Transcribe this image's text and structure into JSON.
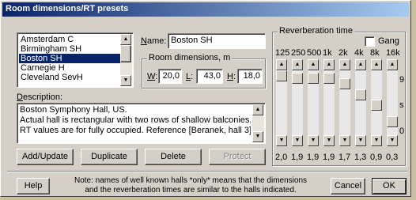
{
  "window": {
    "title": "Room dimensions/RT presets"
  },
  "halls": {
    "items": [
      "Amsterdam C",
      "Birmingham SH",
      "Boston SH",
      "Carnegie H",
      "Cleveland SevH"
    ],
    "selected_index": 2
  },
  "name": {
    "label": "Name:",
    "value": "Boston SH"
  },
  "room_dims": {
    "label": "Room dimensions, m",
    "w_label": "W:",
    "w_value": "20,0",
    "l_label": "L:",
    "l_value": "43,0",
    "h_label": "H:",
    "h_value": "18,0"
  },
  "description": {
    "label": "Description:",
    "text": "Boston Symphony Hall, US.\nActual hall is rectangular with two rows of shallow balconies,\nRT values are for fully occupied. Reference [Beranek, hall 3]."
  },
  "buttons": {
    "add_update": "Add/Update",
    "duplicate": "Duplicate",
    "delete": "Delete",
    "protect": "Protect",
    "help": "Help",
    "cancel": "Cancel",
    "ok": "OK"
  },
  "reverb": {
    "label": "Reverberation time",
    "gang_label": "Gang",
    "gang_checked": false,
    "freqs": [
      "125",
      "250",
      "500",
      "1k",
      "2k",
      "4k",
      "8k",
      "16k"
    ],
    "values": [
      "2,0",
      "1,9",
      "1,9",
      "1,9",
      "1,7",
      "1,3",
      "0,9",
      "0,3"
    ],
    "scale_top": "9",
    "scale_unit": "s",
    "scale_bottom": "0"
  },
  "note": {
    "line1": "Note:  names of well known halls *only* means that the dimensions",
    "line2": "and the reverberation times are similar to the halls indicated."
  }
}
